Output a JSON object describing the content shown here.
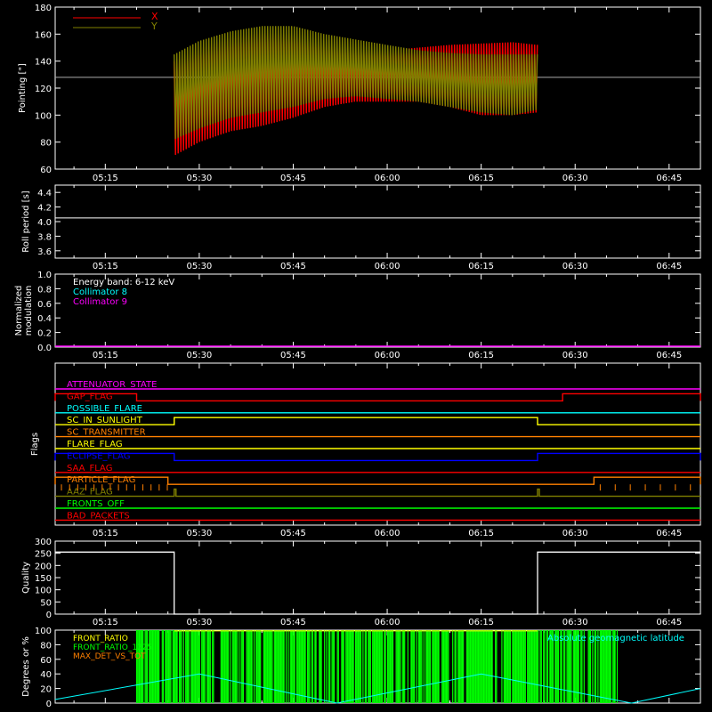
{
  "time_ticks": [
    "05:15",
    "05:30",
    "05:45",
    "06:00",
    "06:15",
    "06:30",
    "06:45"
  ],
  "chart_data": [
    {
      "type": "line",
      "panel": "pointing",
      "ylabel": "Pointing [\"]",
      "ylim": [
        60,
        180
      ],
      "yticks": [
        60,
        80,
        100,
        120,
        140,
        160,
        180
      ],
      "xlim": [
        "05:07",
        "06:50"
      ],
      "reference_line": 128,
      "legend": [
        {
          "name": "X",
          "color": "#ff0000"
        },
        {
          "name": "Y",
          "color": "#808000"
        }
      ],
      "series": [
        {
          "name": "X",
          "color": "#ff0000",
          "x": [
            "05:26",
            "05:30",
            "05:35",
            "05:40",
            "05:45",
            "05:50",
            "05:55",
            "06:00",
            "06:05",
            "06:10",
            "06:15",
            "06:20",
            "06:24"
          ],
          "upper": [
            140,
            150,
            158,
            162,
            160,
            152,
            148,
            148,
            150,
            152,
            153,
            154,
            152
          ],
          "lower": [
            70,
            80,
            88,
            92,
            98,
            106,
            110,
            110,
            110,
            106,
            100,
            100,
            102
          ]
        },
        {
          "name": "Y",
          "color": "#808000",
          "x": [
            "05:26",
            "05:30",
            "05:35",
            "05:40",
            "05:45",
            "05:50",
            "05:55",
            "06:00",
            "06:05",
            "06:10",
            "06:15",
            "06:20",
            "06:24"
          ],
          "upper": [
            145,
            155,
            162,
            166,
            166,
            160,
            156,
            152,
            148,
            146,
            145,
            145,
            145
          ],
          "lower": [
            82,
            90,
            98,
            102,
            106,
            112,
            114,
            112,
            110,
            106,
            102,
            100,
            104
          ]
        }
      ]
    },
    {
      "type": "line",
      "panel": "roll_period",
      "ylabel": "Roll period [s]",
      "ylim": [
        3.5,
        4.5
      ],
      "yticks": [
        3.6,
        3.8,
        4.0,
        4.2,
        4.4
      ],
      "series": [
        {
          "name": "Roll period",
          "color": "#ffffff",
          "x": [
            "05:07",
            "06:50"
          ],
          "values": [
            4.05,
            4.05
          ]
        }
      ]
    },
    {
      "type": "line",
      "panel": "modulation",
      "ylabel": "Normalized modulation",
      "ylim": [
        0,
        1
      ],
      "yticks": [
        0.0,
        0.2,
        0.4,
        0.6,
        0.8,
        1.0
      ],
      "annotations": [
        {
          "text": "Energy band: 6-12 keV",
          "color": "#ffffff"
        },
        {
          "text": "Collimator 8",
          "color": "#00ffff"
        },
        {
          "text": "Collimator 9",
          "color": "#ff00ff"
        }
      ],
      "series": [
        {
          "name": "Collimator 9",
          "color": "#ff00ff",
          "x": [
            "05:07",
            "06:50"
          ],
          "values": [
            0.0,
            0.0
          ]
        }
      ]
    },
    {
      "type": "line",
      "panel": "flags",
      "ylabel": "Flags",
      "flags": [
        {
          "name": "ATTENUATOR_STATE",
          "color": "#ff00ff",
          "high_intervals": []
        },
        {
          "name": "GAP_FLAG",
          "color": "#ff0000",
          "high_intervals": [
            [
              "05:07",
              "05:20"
            ],
            [
              "06:28",
              "06:50"
            ]
          ]
        },
        {
          "name": "POSSIBLE_FLARE",
          "color": "#00ffff",
          "high_intervals": []
        },
        {
          "name": "SC_IN_SUNLIGHT",
          "color": "#ffff00",
          "high_intervals": [
            [
              "05:26",
              "06:24"
            ]
          ]
        },
        {
          "name": "SC_TRANSMITTER",
          "color": "#ff8000",
          "high_intervals": []
        },
        {
          "name": "FLARE_FLAG",
          "color": "#ffff00",
          "high_intervals": []
        },
        {
          "name": "ECLIPSE_FLAG",
          "color": "#0000ff",
          "high_intervals": [
            [
              "05:07",
              "05:26"
            ],
            [
              "06:24",
              "06:50"
            ]
          ]
        },
        {
          "name": "SAA_FLAG",
          "color": "#ff0000",
          "high_intervals": []
        },
        {
          "name": "PARTICLE_FLAG",
          "color": "#ff8000",
          "high_intervals": [
            [
              "05:07",
              "05:25"
            ],
            [
              "06:33",
              "06:50"
            ]
          ]
        },
        {
          "name": "AAZ_FLAG",
          "color": "#808000",
          "high_intervals": [
            [
              "05:26",
              "05:26"
            ],
            [
              "06:24",
              "06:24"
            ]
          ]
        },
        {
          "name": "FRONTS_OFF",
          "color": "#00ff00",
          "high_intervals": []
        },
        {
          "name": "BAD_PACKETS",
          "color": "#ff0000",
          "high_intervals": []
        }
      ]
    },
    {
      "type": "line",
      "panel": "quality",
      "ylabel": "Quality",
      "ylim": [
        0,
        300
      ],
      "yticks": [
        0,
        50,
        100,
        150,
        200,
        250,
        300
      ],
      "series": [
        {
          "name": "Quality",
          "color": "#ffffff",
          "x": [
            "05:07",
            "05:26",
            "05:26",
            "06:24",
            "06:24",
            "06:50"
          ],
          "values": [
            255,
            255,
            0,
            0,
            255,
            255
          ]
        }
      ]
    },
    {
      "type": "line",
      "panel": "front_ratio",
      "ylabel": "Degrees or %",
      "ylim": [
        0,
        100
      ],
      "yticks": [
        0,
        20,
        40,
        60,
        80,
        100
      ],
      "legend": [
        {
          "name": "FRONT_RATIO",
          "color": "#ffff00"
        },
        {
          "name": "FRONT_RATIO_1225",
          "color": "#00ff00"
        },
        {
          "name": "MAX_DET_VS_TOT",
          "color": "#ff8000"
        },
        {
          "name": "Absolute geomagnetic latitude",
          "color": "#00ffff"
        }
      ],
      "green_bar_span": [
        "05:20",
        "06:37"
      ],
      "series": [
        {
          "name": "Absolute geomagnetic latitude",
          "color": "#00ffff",
          "x": [
            "05:07",
            "05:30",
            "05:52",
            "06:15",
            "06:39",
            "06:50"
          ],
          "values": [
            5,
            40,
            0,
            40,
            0,
            20
          ]
        }
      ]
    }
  ]
}
